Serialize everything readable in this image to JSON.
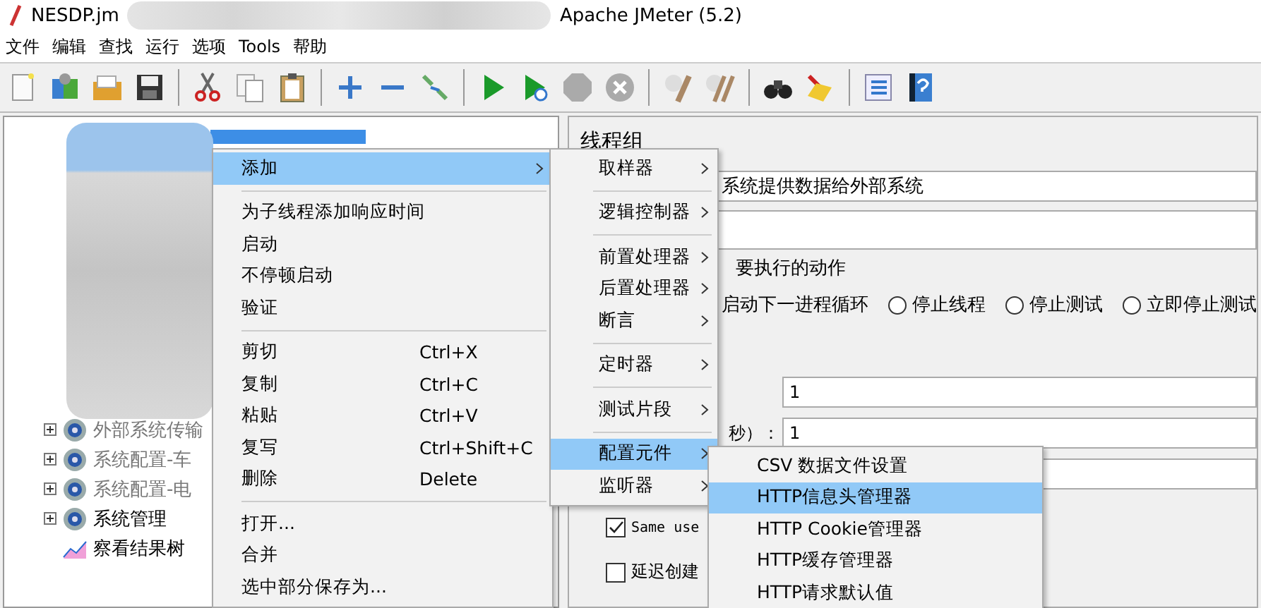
{
  "window": {
    "title": "NESDP.jm",
    "app_title": "Apache JMeter (5.2)"
  },
  "menu_bar": [
    "文件",
    "编辑",
    "查找",
    "运行",
    "选项",
    "Tools",
    "帮助"
  ],
  "tree": {
    "items": [
      {
        "label": "外部系统传输",
        "kind": "group",
        "disabled": true
      },
      {
        "label": "系统配置-车",
        "kind": "group",
        "disabled": true
      },
      {
        "label": "系统配置-电",
        "kind": "group",
        "disabled": true
      },
      {
        "label": "系统管理",
        "kind": "group",
        "disabled": false
      },
      {
        "label": "察看结果树",
        "kind": "listener",
        "disabled": false
      }
    ]
  },
  "panel": {
    "title": "线程组",
    "name_value": "系统提供数据给外部系统",
    "action_legend": "要执行的动作",
    "first_option": "启动下一进程循环",
    "radios": [
      {
        "label": "停止线程",
        "selected": false
      },
      {
        "label": "停止测试",
        "selected": false
      },
      {
        "label": "立即停止测试",
        "selected": false
      }
    ],
    "fields": [
      {
        "value": "1"
      },
      {
        "label": "秒）：",
        "value": "1"
      }
    ],
    "checkboxes": [
      {
        "label": "Same use",
        "checked": true,
        "mono": true
      },
      {
        "label": "延迟创建",
        "checked": false,
        "mono": false
      }
    ]
  },
  "context_menu": {
    "groups": [
      [
        {
          "label": "添加",
          "submenu": true,
          "selected": true
        }
      ],
      [
        {
          "label": "为子线程添加响应时间",
          "submenu": false,
          "selected": false
        },
        {
          "label": "启动",
          "submenu": false,
          "selected": false
        },
        {
          "label": "不停顿启动",
          "submenu": false,
          "selected": false
        },
        {
          "label": "验证",
          "submenu": false,
          "selected": false
        }
      ],
      [
        {
          "label": "剪切",
          "shortcut": "Ctrl+X",
          "submenu": false,
          "selected": false
        },
        {
          "label": "复制",
          "shortcut": "Ctrl+C",
          "submenu": false,
          "selected": false
        },
        {
          "label": "粘贴",
          "shortcut": "Ctrl+V",
          "submenu": false,
          "selected": false
        },
        {
          "label": "复写",
          "shortcut": "Ctrl+Shift+C",
          "submenu": false,
          "selected": false
        },
        {
          "label": "删除",
          "shortcut": "Delete",
          "submenu": false,
          "selected": false
        }
      ],
      [
        {
          "label": "打开...",
          "submenu": false,
          "selected": false
        },
        {
          "label": "合并",
          "submenu": false,
          "selected": false
        },
        {
          "label": "选中部分保存为...",
          "submenu": false,
          "selected": false
        }
      ]
    ]
  },
  "add_submenu": {
    "groups": [
      [
        {
          "label": "取样器",
          "submenu": true,
          "selected": false
        }
      ],
      [
        {
          "label": "逻辑控制器",
          "submenu": true,
          "selected": false
        }
      ],
      [
        {
          "label": "前置处理器",
          "submenu": true,
          "selected": false
        },
        {
          "label": "后置处理器",
          "submenu": true,
          "selected": false
        },
        {
          "label": "断言",
          "submenu": true,
          "selected": false
        }
      ],
      [
        {
          "label": "定时器",
          "submenu": true,
          "selected": false
        }
      ],
      [
        {
          "label": "测试片段",
          "submenu": true,
          "selected": false
        }
      ],
      [
        {
          "label": "配置元件",
          "submenu": true,
          "selected": true
        },
        {
          "label": "监听器",
          "submenu": true,
          "selected": false
        }
      ]
    ]
  },
  "config_submenu": {
    "items": [
      {
        "label": "CSV 数据文件设置",
        "selected": false
      },
      {
        "label": "HTTP信息头管理器",
        "selected": true
      },
      {
        "label": "HTTP Cookie管理器",
        "selected": false
      },
      {
        "label": "HTTP缓存管理器",
        "selected": false
      },
      {
        "label": "HTTP请求默认值",
        "selected": false
      }
    ]
  }
}
